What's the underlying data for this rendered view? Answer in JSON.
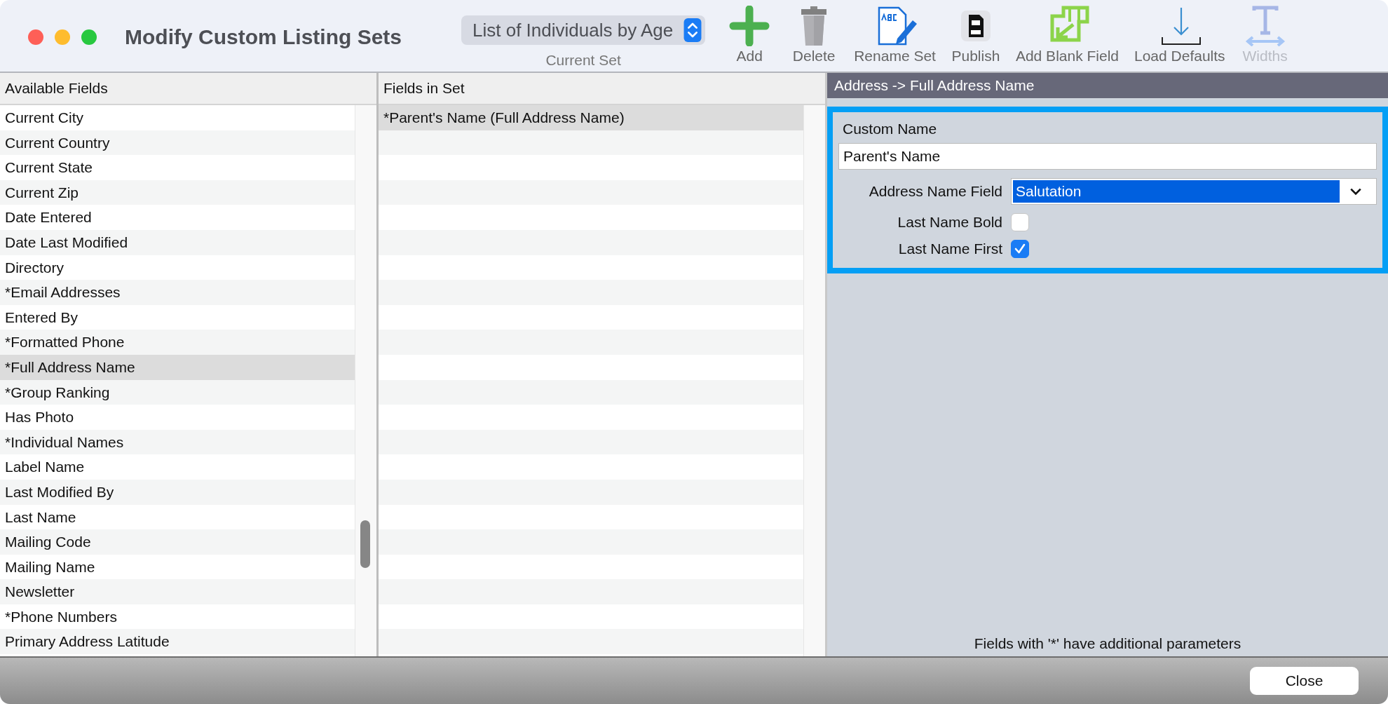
{
  "window": {
    "title": "Modify Custom Listing Sets"
  },
  "current_set": {
    "value": "List of Individuals by Age",
    "label": "Current Set"
  },
  "toolbar": [
    {
      "kind": "add",
      "label": "Add",
      "disabled": false
    },
    {
      "kind": "delete",
      "label": "Delete",
      "disabled": false
    },
    {
      "kind": "rename",
      "label": "Rename Set",
      "disabled": false
    },
    {
      "kind": "publish",
      "label": "Publish",
      "disabled": false
    },
    {
      "kind": "add-blank",
      "label": "Add Blank Field",
      "disabled": false
    },
    {
      "kind": "load",
      "label": "Load Defaults",
      "disabled": false
    },
    {
      "kind": "widths",
      "label": "Widths",
      "disabled": true
    }
  ],
  "available_fields": {
    "heading": "Available Fields",
    "items": [
      {
        "label": "Current City",
        "selected": false
      },
      {
        "label": "Current Country",
        "selected": false
      },
      {
        "label": "Current State",
        "selected": false
      },
      {
        "label": "Current Zip",
        "selected": false
      },
      {
        "label": "Date Entered",
        "selected": false
      },
      {
        "label": "Date Last Modified",
        "selected": false
      },
      {
        "label": "Directory",
        "selected": false
      },
      {
        "label": "*Email Addresses",
        "selected": false
      },
      {
        "label": "Entered By",
        "selected": false
      },
      {
        "label": "*Formatted Phone",
        "selected": false
      },
      {
        "label": "*Full Address Name",
        "selected": true
      },
      {
        "label": "*Group Ranking",
        "selected": false
      },
      {
        "label": "Has Photo",
        "selected": false
      },
      {
        "label": "*Individual Names",
        "selected": false
      },
      {
        "label": "Label Name",
        "selected": false
      },
      {
        "label": "Last Modified By",
        "selected": false
      },
      {
        "label": "Last Name",
        "selected": false
      },
      {
        "label": "Mailing Code",
        "selected": false
      },
      {
        "label": "Mailing Name",
        "selected": false
      },
      {
        "label": "Newsletter",
        "selected": false
      },
      {
        "label": "*Phone Numbers",
        "selected": false
      },
      {
        "label": "Primary Address Latitude",
        "selected": false
      }
    ]
  },
  "fields_in_set": {
    "heading": "Fields in Set",
    "items": [
      {
        "label": "*Parent's Name (Full Address Name)",
        "selected": true
      }
    ]
  },
  "detail": {
    "heading": "Address -> Full Address Name",
    "custom_name": {
      "label": "Custom Name",
      "value": "Parent's Name"
    },
    "address_name_field": {
      "label": "Address Name Field",
      "value": "Salutation"
    },
    "options": [
      {
        "label": "Last Name Bold",
        "checked": false
      },
      {
        "label": "Last Name First",
        "checked": true
      }
    ],
    "note": "Fields with '*' have additional parameters"
  },
  "buttons": [
    "Close"
  ]
}
